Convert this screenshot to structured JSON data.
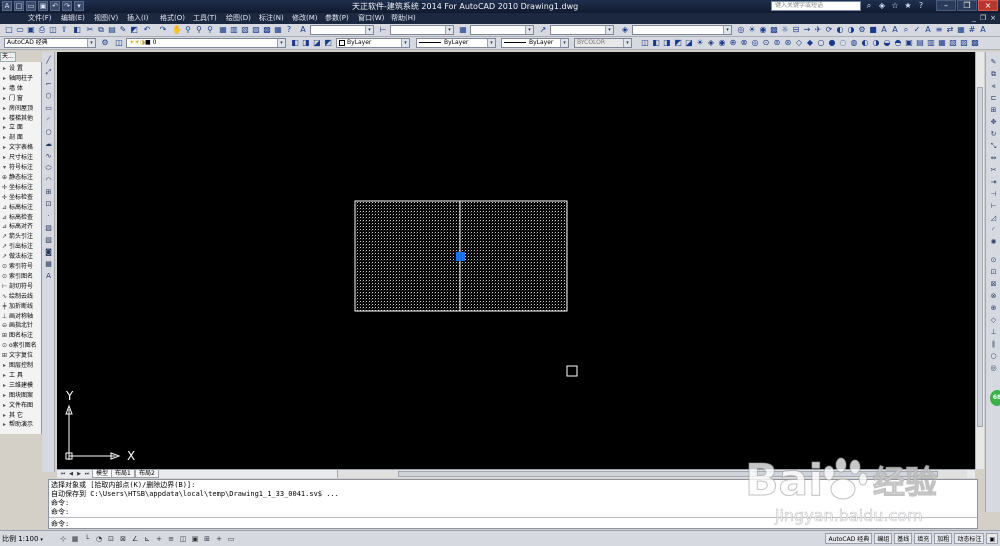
{
  "titlebar": {
    "title": "天正软件-建筑系统 2014  For AutoCAD 2010        Drawing1.dwg",
    "search_placeholder": "键入关键字或短语",
    "quick_access": [
      "new-icon",
      "open-icon",
      "save-icon",
      "undo-icon",
      "redo-icon",
      "more-icon"
    ],
    "window_controls": [
      "minimize",
      "restore",
      "close"
    ]
  },
  "menu": {
    "items": [
      "文件(F)",
      "编辑(E)",
      "视图(V)",
      "插入(I)",
      "格式(O)",
      "工具(T)",
      "绘图(D)",
      "标注(N)",
      "修改(M)",
      "参数(P)",
      "窗口(W)",
      "帮助(H)"
    ],
    "right_controls": [
      "_",
      "❐",
      "×"
    ]
  },
  "toolbar2": {
    "workspace": "AutoCAD 经典",
    "layer": "0",
    "color": "ByLayer",
    "linetype": "ByLayer",
    "lineweight": "ByLayer",
    "plotstyle": "BYCOLOR"
  },
  "palette": {
    "title": "天...",
    "items": [
      {
        "icon": "▸",
        "label": "设    置",
        "kind": "menu"
      },
      {
        "icon": "▸",
        "label": "轴网柱子",
        "kind": "menu"
      },
      {
        "icon": "▸",
        "label": "墙    体",
        "kind": "menu"
      },
      {
        "icon": "▸",
        "label": "门    窗",
        "kind": "menu"
      },
      {
        "icon": "▸",
        "label": "房间屋顶",
        "kind": "menu"
      },
      {
        "icon": "▸",
        "label": "楼梯其他",
        "kind": "menu"
      },
      {
        "icon": "▸",
        "label": "立    面",
        "kind": "menu"
      },
      {
        "icon": "▸",
        "label": "剖    面",
        "kind": "menu"
      },
      {
        "icon": "▸",
        "label": "文字表格",
        "kind": "menu"
      },
      {
        "icon": "▸",
        "label": "尺寸标注",
        "kind": "menu"
      },
      {
        "icon": "▾",
        "label": "符号标注",
        "kind": "menu"
      },
      {
        "icon": "⊕",
        "label": "静态标注",
        "kind": "tool"
      },
      {
        "icon": "✢",
        "label": "坐标标注",
        "kind": "tool"
      },
      {
        "icon": "✢",
        "label": "坐标检查",
        "kind": "tool"
      },
      {
        "icon": "⊿",
        "label": "标高标注",
        "kind": "tool"
      },
      {
        "icon": "⊿",
        "label": "标高检查",
        "kind": "tool"
      },
      {
        "icon": "⊿",
        "label": "标高对齐",
        "kind": "tool"
      },
      {
        "icon": "↗",
        "label": "箭头引注",
        "kind": "tool"
      },
      {
        "icon": "↗",
        "label": "引出标注",
        "kind": "tool"
      },
      {
        "icon": "↗",
        "label": "做法标注",
        "kind": "tool"
      },
      {
        "icon": "⊙",
        "label": "索引符号",
        "kind": "tool"
      },
      {
        "icon": "⊙",
        "label": "索引图名",
        "kind": "tool"
      },
      {
        "icon": "⊢",
        "label": "剖切符号",
        "kind": "tool"
      },
      {
        "icon": "∿",
        "label": "绘制云线",
        "kind": "tool"
      },
      {
        "icon": "╪",
        "label": "加折断线",
        "kind": "tool"
      },
      {
        "icon": "⊥",
        "label": "画对称轴",
        "kind": "tool"
      },
      {
        "icon": "⊖",
        "label": "画指北针",
        "kind": "tool"
      },
      {
        "icon": "⊞",
        "label": "图名标注",
        "kind": "tool"
      },
      {
        "icon": "⊙",
        "label": "o索引图名",
        "kind": "tool"
      },
      {
        "icon": "⊞",
        "label": "文字复位",
        "kind": "tool"
      },
      {
        "icon": "▸",
        "label": "图层控制",
        "kind": "menu"
      },
      {
        "icon": "▸",
        "label": "工    具",
        "kind": "menu"
      },
      {
        "icon": "▸",
        "label": "三维建模",
        "kind": "menu"
      },
      {
        "icon": "▸",
        "label": "图块图案",
        "kind": "menu"
      },
      {
        "icon": "▸",
        "label": "文件布图",
        "kind": "menu"
      },
      {
        "icon": "▸",
        "label": "其    它",
        "kind": "menu"
      },
      {
        "icon": "▸",
        "label": "帮助演示",
        "kind": "menu"
      }
    ]
  },
  "ucs": {
    "x_label": "X",
    "y_label": "Y"
  },
  "tabs": {
    "items": [
      "模型",
      "布局1",
      "布局2"
    ],
    "active": "模型"
  },
  "command": {
    "lines": [
      "选择对象或 [拾取内部点(K)/删除边界(B)]:",
      "自动保存到 C:\\Users\\HTSB\\appdata\\local\\temp\\Drawing1_1_33_0041.sv$ ...",
      "命令:",
      "命令:"
    ],
    "prompt": "命令:"
  },
  "statusbar": {
    "scale": "比例 1:100",
    "right_buttons": [
      "AutoCAD 经典",
      "编组",
      "基线",
      "填充",
      "加粗",
      "动态标注"
    ]
  },
  "badge": "68",
  "watermark": {
    "brand": "Bai",
    "brand_cn": "经验",
    "url": "jingyan.baidu.com"
  },
  "colors": {
    "canvas_bg": "#000000",
    "grip_blue": "#1a73e8",
    "hatch_white": "#ffffff",
    "titlebar_dark": "#1f2f4e"
  }
}
